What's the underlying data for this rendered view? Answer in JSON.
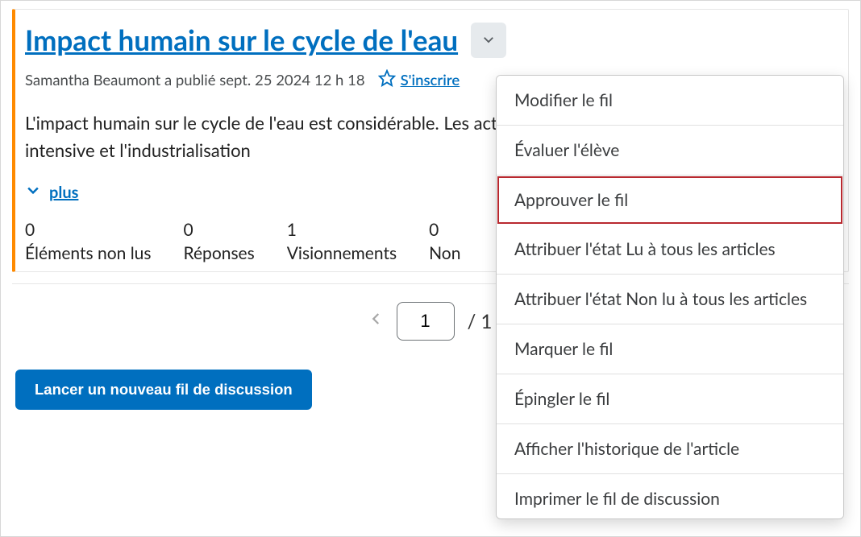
{
  "thread": {
    "title": "Impact humain sur le cycle de l'eau",
    "author_line": "Samantha Beaumont a publié sept. 25 2024 12 h 18",
    "subscribe_label": "S'inscrire",
    "body": "L'impact humain sur le cycle de l'eau est considérable. Les activités telles que l'urbanisation, l'agriculture intensive et l'industrialisation",
    "more_label": "plus"
  },
  "stats": [
    {
      "value": "0",
      "label": "Éléments non lus"
    },
    {
      "value": "0",
      "label": "Réponses"
    },
    {
      "value": "1",
      "label": "Visionnements"
    },
    {
      "value": "0",
      "label": "Non"
    }
  ],
  "pager": {
    "current": "1",
    "total": "/ 1"
  },
  "actions": {
    "new_thread": "Lancer un nouveau fil de discussion"
  },
  "menu": [
    {
      "label": "Modifier le fil",
      "highlighted": false
    },
    {
      "label": "Évaluer l'élève",
      "highlighted": false
    },
    {
      "label": "Approuver le fil",
      "highlighted": true
    },
    {
      "label": "Attribuer l'état Lu à tous les articles",
      "highlighted": false
    },
    {
      "label": "Attribuer l'état Non lu à tous les articles",
      "highlighted": false
    },
    {
      "label": "Marquer le fil",
      "highlighted": false
    },
    {
      "label": "Épingler le fil",
      "highlighted": false
    },
    {
      "label": "Afficher l'historique de l'article",
      "highlighted": false
    },
    {
      "label": "Imprimer le fil de discussion",
      "highlighted": false
    }
  ]
}
